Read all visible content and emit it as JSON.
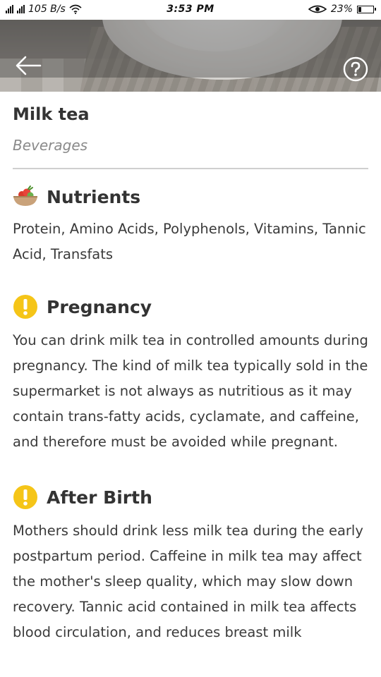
{
  "status_bar": {
    "network_speed": "105 B/s",
    "time": "3:53 PM",
    "battery": "23%",
    "battery_level": 0.23
  },
  "header": {
    "back_icon": "arrow-left-icon",
    "help_icon": "question-circle-icon"
  },
  "food": {
    "name": "Milk tea",
    "category": "Beverages"
  },
  "sections": {
    "nutrients": {
      "icon": "fruit-basket-icon",
      "title": "Nutrients",
      "text": "Protein, Amino Acids, Polyphenols, Vitamins, Tannic Acid, Transfats"
    },
    "pregnancy": {
      "icon": "warning-icon",
      "title": "Pregnancy",
      "text": "You can drink milk tea in controlled amounts during pregnancy. The kind of milk tea typically sold in the supermarket is not always as nutritious as it may contain trans-fatty acids, cyclamate, and caffeine, and therefore must be avoided while pregnant."
    },
    "after_birth": {
      "icon": "warning-icon",
      "title": "After Birth",
      "text": "Mothers should drink less milk tea during the early postpartum period. Caffeine in milk tea may affect the mother's sleep quality, which may slow down recovery. Tannic acid contained in milk tea affects blood circulation, and reduces breast milk"
    }
  },
  "colors": {
    "warning": "#f5c518",
    "title_text": "#333333",
    "category_text": "#8a8a8a",
    "divider": "#cfcfcf"
  }
}
